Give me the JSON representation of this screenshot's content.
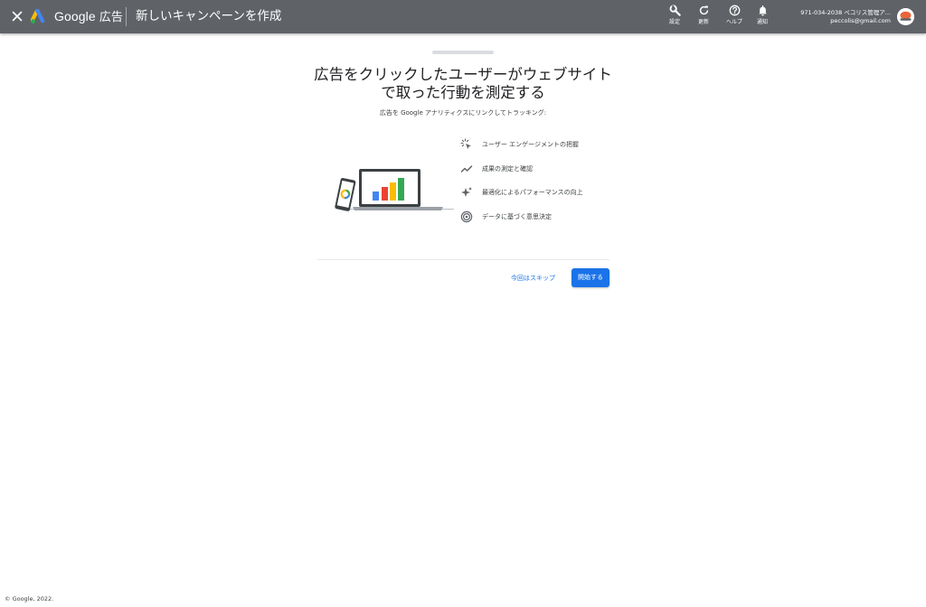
{
  "header": {
    "brand": "Google",
    "brand_ads": "広告",
    "title": "新しいキャンペーンを作成",
    "tools": {
      "settings": "設定",
      "refresh": "更新",
      "help": "ヘルプ",
      "notifications": "通知"
    },
    "account_id": "971-034-2038 ペコリス管理ア...",
    "account_email": "peccolis@gmail.com"
  },
  "main": {
    "headline_line1": "広告をクリックしたユーザーがウェブサイト",
    "headline_line2": "で取った行動を測定する",
    "subheading": "広告を Google アナリティクスにリンクしてトラッキング:",
    "features": [
      {
        "icon": "cursor-click-icon",
        "label": "ユーザー エンゲージメントの把握"
      },
      {
        "icon": "trending-line-icon",
        "label": "成果の測定と確認"
      },
      {
        "icon": "sparkle-icon",
        "label": "最適化によるパフォーマンスの向上"
      },
      {
        "icon": "target-icon",
        "label": "データに基づく意思決定"
      }
    ],
    "skip_label": "今回はスキップ",
    "start_label": "開始する"
  },
  "colors": {
    "header_bg": "#5f6368",
    "accent": "#1a73e8",
    "bar_blue": "#4285f4",
    "bar_red": "#ea4335",
    "bar_yellow": "#fbbc04",
    "bar_green": "#34a853"
  },
  "footer": {
    "copyright": "© Google, 2022."
  }
}
